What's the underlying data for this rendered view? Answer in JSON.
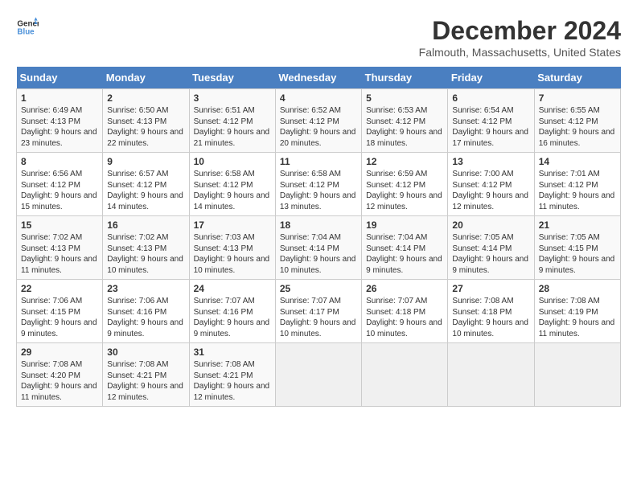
{
  "header": {
    "logo_line1": "General",
    "logo_line2": "Blue",
    "main_title": "December 2024",
    "subtitle": "Falmouth, Massachusetts, United States"
  },
  "days_of_week": [
    "Sunday",
    "Monday",
    "Tuesday",
    "Wednesday",
    "Thursday",
    "Friday",
    "Saturday"
  ],
  "weeks": [
    [
      {
        "day": 1,
        "sunrise": "6:49 AM",
        "sunset": "4:13 PM",
        "daylight": "9 hours and 23 minutes."
      },
      {
        "day": 2,
        "sunrise": "6:50 AM",
        "sunset": "4:13 PM",
        "daylight": "9 hours and 22 minutes."
      },
      {
        "day": 3,
        "sunrise": "6:51 AM",
        "sunset": "4:12 PM",
        "daylight": "9 hours and 21 minutes."
      },
      {
        "day": 4,
        "sunrise": "6:52 AM",
        "sunset": "4:12 PM",
        "daylight": "9 hours and 20 minutes."
      },
      {
        "day": 5,
        "sunrise": "6:53 AM",
        "sunset": "4:12 PM",
        "daylight": "9 hours and 18 minutes."
      },
      {
        "day": 6,
        "sunrise": "6:54 AM",
        "sunset": "4:12 PM",
        "daylight": "9 hours and 17 minutes."
      },
      {
        "day": 7,
        "sunrise": "6:55 AM",
        "sunset": "4:12 PM",
        "daylight": "9 hours and 16 minutes."
      }
    ],
    [
      {
        "day": 8,
        "sunrise": "6:56 AM",
        "sunset": "4:12 PM",
        "daylight": "9 hours and 15 minutes."
      },
      {
        "day": 9,
        "sunrise": "6:57 AM",
        "sunset": "4:12 PM",
        "daylight": "9 hours and 14 minutes."
      },
      {
        "day": 10,
        "sunrise": "6:58 AM",
        "sunset": "4:12 PM",
        "daylight": "9 hours and 14 minutes."
      },
      {
        "day": 11,
        "sunrise": "6:58 AM",
        "sunset": "4:12 PM",
        "daylight": "9 hours and 13 minutes."
      },
      {
        "day": 12,
        "sunrise": "6:59 AM",
        "sunset": "4:12 PM",
        "daylight": "9 hours and 12 minutes."
      },
      {
        "day": 13,
        "sunrise": "7:00 AM",
        "sunset": "4:12 PM",
        "daylight": "9 hours and 12 minutes."
      },
      {
        "day": 14,
        "sunrise": "7:01 AM",
        "sunset": "4:12 PM",
        "daylight": "9 hours and 11 minutes."
      }
    ],
    [
      {
        "day": 15,
        "sunrise": "7:02 AM",
        "sunset": "4:13 PM",
        "daylight": "9 hours and 11 minutes."
      },
      {
        "day": 16,
        "sunrise": "7:02 AM",
        "sunset": "4:13 PM",
        "daylight": "9 hours and 10 minutes."
      },
      {
        "day": 17,
        "sunrise": "7:03 AM",
        "sunset": "4:13 PM",
        "daylight": "9 hours and 10 minutes."
      },
      {
        "day": 18,
        "sunrise": "7:04 AM",
        "sunset": "4:14 PM",
        "daylight": "9 hours and 10 minutes."
      },
      {
        "day": 19,
        "sunrise": "7:04 AM",
        "sunset": "4:14 PM",
        "daylight": "9 hours and 9 minutes."
      },
      {
        "day": 20,
        "sunrise": "7:05 AM",
        "sunset": "4:14 PM",
        "daylight": "9 hours and 9 minutes."
      },
      {
        "day": 21,
        "sunrise": "7:05 AM",
        "sunset": "4:15 PM",
        "daylight": "9 hours and 9 minutes."
      }
    ],
    [
      {
        "day": 22,
        "sunrise": "7:06 AM",
        "sunset": "4:15 PM",
        "daylight": "9 hours and 9 minutes."
      },
      {
        "day": 23,
        "sunrise": "7:06 AM",
        "sunset": "4:16 PM",
        "daylight": "9 hours and 9 minutes."
      },
      {
        "day": 24,
        "sunrise": "7:07 AM",
        "sunset": "4:16 PM",
        "daylight": "9 hours and 9 minutes."
      },
      {
        "day": 25,
        "sunrise": "7:07 AM",
        "sunset": "4:17 PM",
        "daylight": "9 hours and 10 minutes."
      },
      {
        "day": 26,
        "sunrise": "7:07 AM",
        "sunset": "4:18 PM",
        "daylight": "9 hours and 10 minutes."
      },
      {
        "day": 27,
        "sunrise": "7:08 AM",
        "sunset": "4:18 PM",
        "daylight": "9 hours and 10 minutes."
      },
      {
        "day": 28,
        "sunrise": "7:08 AM",
        "sunset": "4:19 PM",
        "daylight": "9 hours and 11 minutes."
      }
    ],
    [
      {
        "day": 29,
        "sunrise": "7:08 AM",
        "sunset": "4:20 PM",
        "daylight": "9 hours and 11 minutes."
      },
      {
        "day": 30,
        "sunrise": "7:08 AM",
        "sunset": "4:21 PM",
        "daylight": "9 hours and 12 minutes."
      },
      {
        "day": 31,
        "sunrise": "7:08 AM",
        "sunset": "4:21 PM",
        "daylight": "9 hours and 12 minutes."
      },
      null,
      null,
      null,
      null
    ]
  ]
}
